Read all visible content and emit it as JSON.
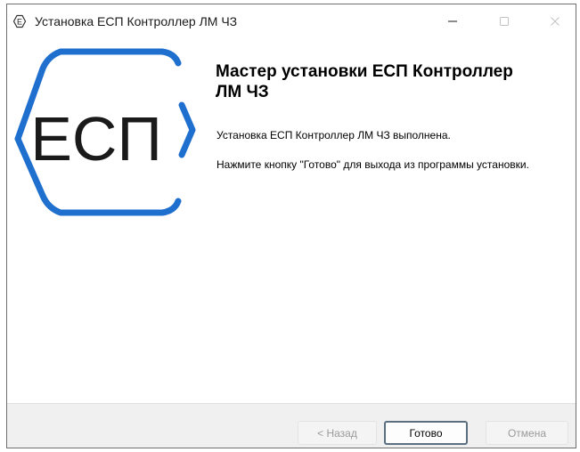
{
  "window": {
    "title": "Установка ЕСП Контроллер ЛМ ЧЗ",
    "app_icon_letter": "Е",
    "controls": {
      "minimize_icon": "minimize-icon",
      "maximize_icon": "maximize-icon",
      "close_icon": "close-icon"
    }
  },
  "logo": {
    "text": "ЕСП",
    "color": "#1f6fcf"
  },
  "content": {
    "heading": "Мастер установки ЕСП Контроллер ЛМ ЧЗ",
    "message_completed": "Установка ЕСП Контроллер ЛМ ЧЗ выполнена.",
    "message_exit": "Нажмите кнопку \"Готово\" для выхода из программы установки."
  },
  "buttons": {
    "back": "< Назад",
    "finish": "Готово",
    "cancel": "Отмена"
  }
}
